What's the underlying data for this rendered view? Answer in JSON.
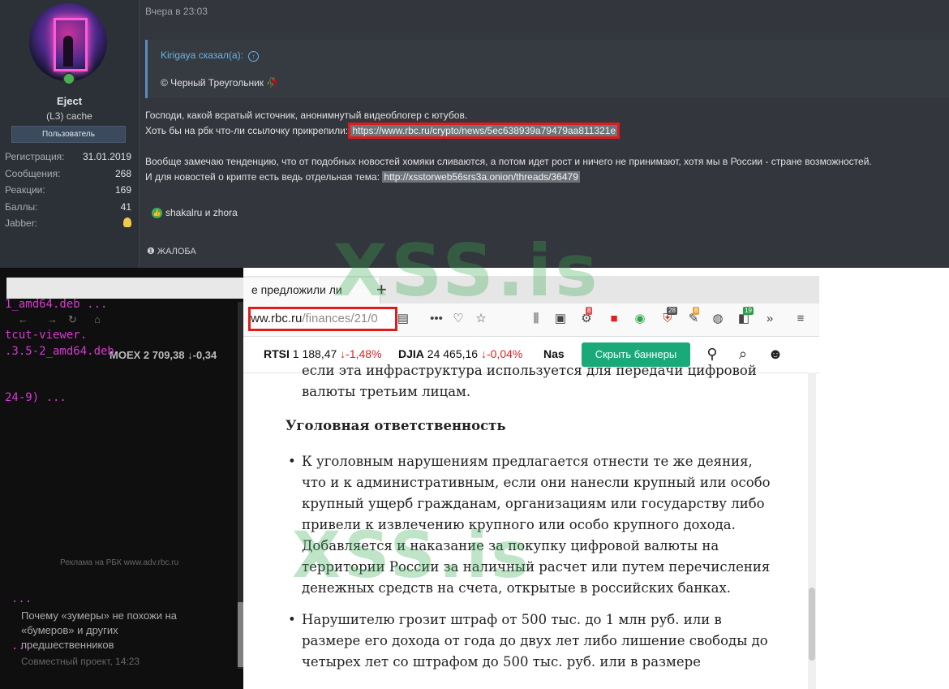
{
  "post": {
    "time": "Вчера в 23:03",
    "user": {
      "name": "Eject",
      "title": "(L3) cache",
      "role": "Пользователь",
      "stats": [
        {
          "label": "Регистрация:",
          "value": "31.01.2019"
        },
        {
          "label": "Сообщения:",
          "value": "268"
        },
        {
          "label": "Реакции:",
          "value": "169"
        },
        {
          "label": "Баллы:",
          "value": "41"
        },
        {
          "label": "Jabber:",
          "value": ""
        }
      ]
    },
    "quote": {
      "author": "Kirigaya сказал(а):",
      "text": "© Черный Треугольник 🥀"
    },
    "body": {
      "line1": "Господи, какой всратый источник, анонимнутый видеоблогер с ютубов.",
      "line2_prefix": "Хоть бы на рбк что-ли ссылочку прикрепили: ",
      "link1": "https://www.rbc.ru/crypto/news/5ec638939a79479aa811321e",
      "line3": "Вообще замечаю тенденцию, что от подобных новостей хомяки сливаются, а потом идет рост и ничего не принимают, хотя мы в России - стране возможностей.",
      "line4_prefix": "И для новостей о крипте есть ведь отдельная тема: ",
      "link2": "http://xsstorweb56srs3a.onion/threads/36479"
    },
    "reactions": "shakalru и zhora",
    "report": "ЖАЛОБА"
  },
  "terminal": {
    "lines": [
      "1_amd64.deb ...",
      "tcut-viewer.",
      ".3.5-2_amd64.deb",
      "24-9) ...",
      "...",
      "..."
    ],
    "ghost_ad": "Реклама на РБК www.adv.rbc.ru",
    "ghost_headline": "Почему «зумеры» не похожи на «бумеров» и других предшественников",
    "ghost_meta": "Совместный проект, 14:23",
    "ghost_ticker": "MOEX 2 709,38 ↓-0,34"
  },
  "browser": {
    "tab_title": "е предложили ли",
    "url_domain": "ww.rbc.ru",
    "url_path": "/finances/21/0",
    "badges": {
      "b1": "8",
      "b2": "28",
      "b3": "8",
      "b4": "19"
    },
    "ticker": [
      {
        "name": "RTSI",
        "value": "1 188,47",
        "change": "↓-1,48%"
      },
      {
        "name": "DJIA",
        "value": "24 465,16",
        "change": "↓-0,04%"
      },
      {
        "name": "Nas",
        "value": "",
        "change": ""
      }
    ],
    "hide_banners": "Скрыть баннеры",
    "article": {
      "fragment": "если эта инфраструктура используется для передачи цифровой валюты третьим лицам.",
      "subheading": "Уголовная ответственность",
      "bullets": [
        "К уголовным нарушениям предлагается отнести те же деяния, что и к административным, если они нанесли крупный или особо крупный ущерб гражданам, организациям или государству либо привели к извлечению крупного или особо крупного дохода. Добавляется и наказание за покупку цифровой валюты на территории России за наличный расчет или путем перечисления денежных средств на счета, открытые в российских банках.",
        "Нарушителю грозит штраф от 500 тыс. до 1 млн руб. или в размере его дохода от года до двух лет либо лишение свободы до четырех лет со штрафом до 500 тыс. руб. или в размере"
      ]
    }
  },
  "watermark": "XSS.is",
  "colors": {
    "accent_link": "#69b6e8",
    "highlight_box": "#e01b1b",
    "button_green": "#1aa978",
    "negative": "#e21f1f"
  }
}
